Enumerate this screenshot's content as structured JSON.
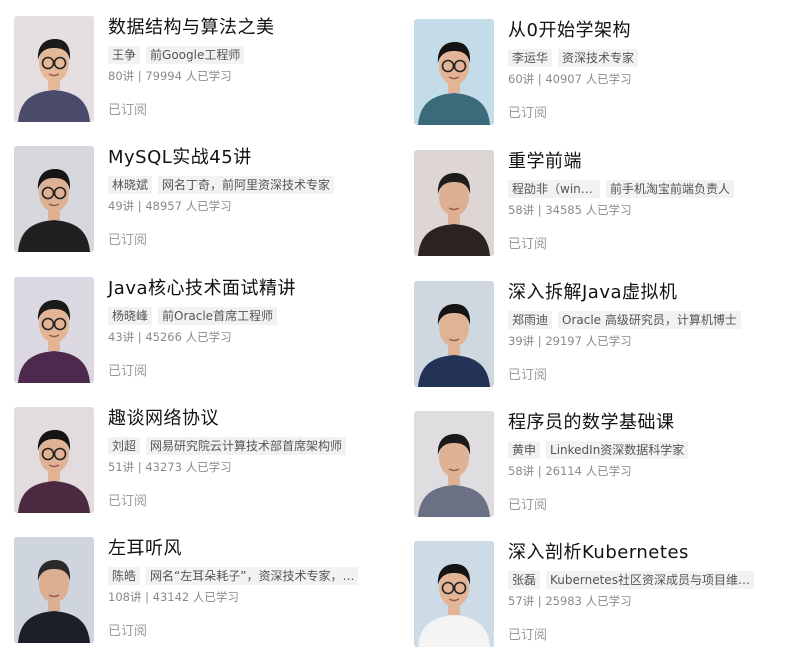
{
  "courses": [
    {
      "title": "数据结构与算法之美",
      "author": "王争",
      "desc": "前Google工程师",
      "lessons": "80讲",
      "learners": "79994 人已学习",
      "status": "已订阅",
      "bg": "#e6dfe1",
      "shirt": "#4a4b6a",
      "skin": "#e4b99a",
      "hair": "#1b1b1b",
      "glasses": true
    },
    {
      "title": "MySQL实战45讲",
      "author": "林晓斌",
      "desc": "网名丁奇，前阿里资深技术专家",
      "lessons": "49讲",
      "learners": "48957 人已学习",
      "status": "已订阅",
      "bg": "#d6d8dd",
      "shirt": "#202020",
      "skin": "#deb195",
      "hair": "#161616",
      "glasses": true
    },
    {
      "title": "Java核心技术面试精讲",
      "author": "杨晓峰",
      "desc": "前Oracle首席工程师",
      "lessons": "43讲",
      "learners": "45266 人已学习",
      "status": "已订阅",
      "bg": "#dcd8e2",
      "shirt": "#4d2a4d",
      "skin": "#e3b495",
      "hair": "#1a1a1a",
      "glasses": true
    },
    {
      "title": "趣谈网络协议",
      "author": "刘超",
      "desc": "网易研究院云计算技术部首席架构师",
      "lessons": "51讲",
      "learners": "43273 人已学习",
      "status": "已订阅",
      "bg": "#e3dcdf",
      "shirt": "#4a2a40",
      "skin": "#e1b294",
      "hair": "#151515",
      "glasses": true
    },
    {
      "title": "左耳听风",
      "author": "陈皓",
      "desc": "网名“左耳朵耗子”，资深技术专家，…",
      "lessons": "108讲",
      "learners": "43142 人已学习",
      "status": "已订阅",
      "bg": "#cfd5df",
      "shirt": "#1d1f26",
      "skin": "#dcae92",
      "hair": "#2a2a2a",
      "glasses": false
    },
    {
      "title": "从0开始学架构",
      "author": "李运华",
      "desc": "资深技术专家",
      "lessons": "60讲",
      "learners": "40907 人已学习",
      "status": "已订阅",
      "bg": "#c4dbe8",
      "shirt": "#3b6a7a",
      "skin": "#e3b496",
      "hair": "#141414",
      "glasses": true
    },
    {
      "title": "重学前端",
      "author": "程劭非（winte…",
      "desc": "前手机淘宝前端负责人",
      "lessons": "58讲",
      "learners": "34585 人已学习",
      "status": "已订阅",
      "bg": "#ddd6d4",
      "shirt": "#2b2222",
      "skin": "#ddb094",
      "hair": "#1c1c1c",
      "glasses": false
    },
    {
      "title": "深入拆解Java虚拟机",
      "author": "郑雨迪",
      "desc": "Oracle 高级研究员，计算机博士",
      "lessons": "39讲",
      "learners": "29197 人已学习",
      "status": "已订阅",
      "bg": "#cfd7e0",
      "shirt": "#233257",
      "skin": "#e0b395",
      "hair": "#141414",
      "glasses": false
    },
    {
      "title": "程序员的数学基础课",
      "author": "黄申",
      "desc": "LinkedIn资深数据科学家",
      "lessons": "58讲",
      "learners": "26114 人已学习",
      "status": "已订阅",
      "bg": "#e0dde0",
      "shirt": "#6a7185",
      "skin": "#e0b294",
      "hair": "#1a1a1a",
      "glasses": false
    },
    {
      "title": "深入剖析Kubernetes",
      "author": "张磊",
      "desc": "Kubernetes社区资深成员与项目维…",
      "lessons": "57讲",
      "learners": "25983 人已学习",
      "status": "已订阅",
      "bg": "#cddbe7",
      "shirt": "#f4f4f4",
      "skin": "#e2b597",
      "hair": "#151515",
      "glasses": true
    }
  ]
}
